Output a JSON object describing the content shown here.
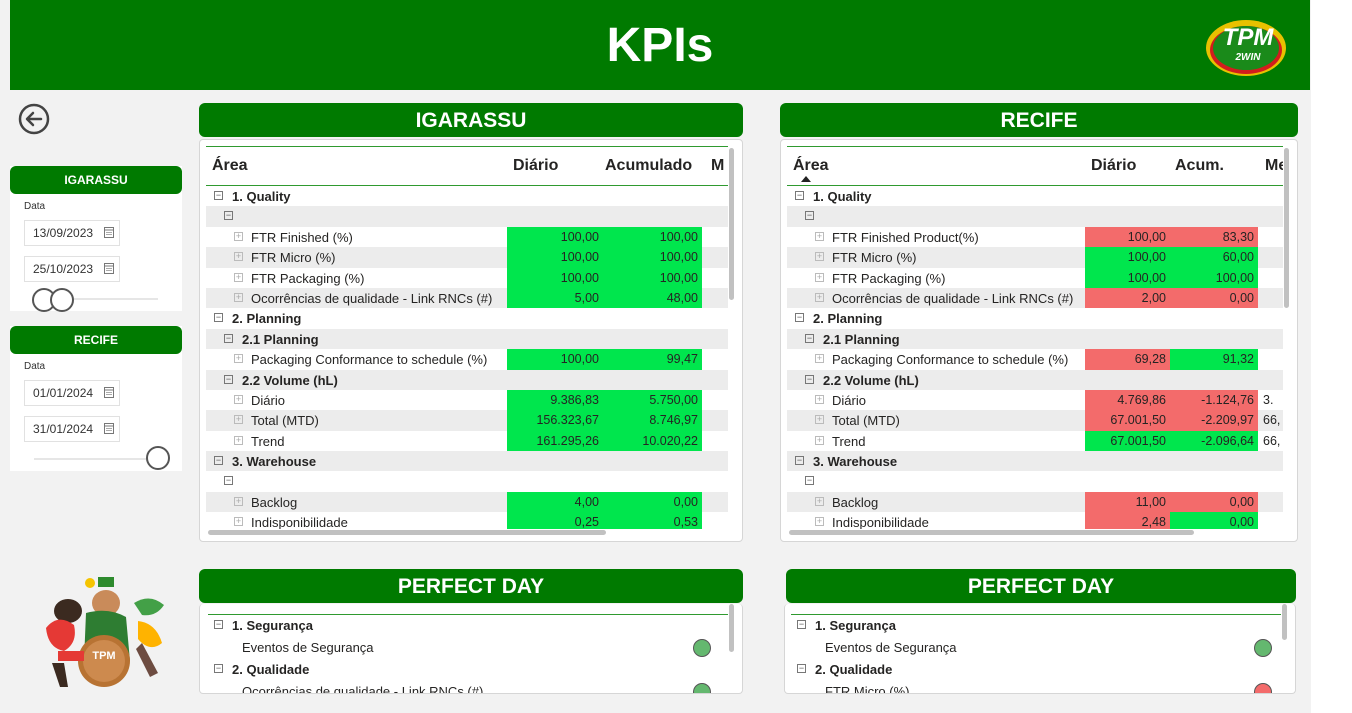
{
  "header": {
    "title": "KPIs",
    "logo_text": "TPM",
    "logo_sub": "2WIN"
  },
  "filters": [
    {
      "title": "IGARASSU",
      "label": "Data",
      "start": "13/09/2023",
      "end": "25/10/2023"
    },
    {
      "title": "RECIFE",
      "label": "Data",
      "start": "01/01/2024",
      "end": "31/01/2024"
    }
  ],
  "igarassu": {
    "title": "IGARASSU",
    "columns": {
      "area": "Área",
      "daily": "Diário",
      "acc": "Acumulado",
      "more": "M"
    },
    "rows": [
      {
        "label": "1. Quality",
        "level": 0,
        "bold": true,
        "exp": "⊟"
      },
      {
        "label": "",
        "level": 1,
        "exp": "⊟"
      },
      {
        "label": "FTR Finished (%)",
        "level": 2,
        "exp": "⊞",
        "d": "100,00",
        "a": "100,00",
        "dc": "g",
        "ac": "g"
      },
      {
        "label": "FTR Micro (%)",
        "level": 2,
        "exp": "⊞",
        "d": "100,00",
        "a": "100,00",
        "dc": "g",
        "ac": "g"
      },
      {
        "label": "FTR Packaging (%)",
        "level": 2,
        "exp": "⊞",
        "d": "100,00",
        "a": "100,00",
        "dc": "g",
        "ac": "g"
      },
      {
        "label": "Ocorrências de qualidade - Link RNCs (#)",
        "level": 2,
        "exp": "⊞",
        "d": "5,00",
        "a": "48,00",
        "dc": "g",
        "ac": "g"
      },
      {
        "label": "2. Planning",
        "level": 0,
        "bold": true,
        "exp": "⊟"
      },
      {
        "label": "2.1 Planning",
        "level": 1,
        "bold": true,
        "exp": "⊟"
      },
      {
        "label": "Packaging Conformance to schedule (%)",
        "level": 2,
        "exp": "⊞",
        "d": "100,00",
        "a": "99,47",
        "dc": "g",
        "ac": "g"
      },
      {
        "label": "2.2 Volume (hL)",
        "level": 1,
        "bold": true,
        "exp": "⊟"
      },
      {
        "label": "Diário",
        "level": 2,
        "exp": "⊞",
        "d": "9.386,83",
        "a": "5.750,00",
        "dc": "g",
        "ac": "g"
      },
      {
        "label": "Total (MTD)",
        "level": 2,
        "exp": "⊞",
        "d": "156.323,67",
        "a": "8.746,97",
        "dc": "g",
        "ac": "g"
      },
      {
        "label": "Trend",
        "level": 2,
        "exp": "⊞",
        "d": "161.295,26",
        "a": "10.020,22",
        "dc": "g",
        "ac": "g"
      },
      {
        "label": "3. Warehouse",
        "level": 0,
        "bold": true,
        "exp": "⊟"
      },
      {
        "label": "",
        "level": 1,
        "exp": "⊟"
      },
      {
        "label": "Backlog",
        "level": 2,
        "exp": "⊞",
        "d": "4,00",
        "a": "0,00",
        "dc": "g",
        "ac": "g"
      },
      {
        "label": "Indisponibilidade",
        "level": 2,
        "exp": "⊞",
        "d": "0,25",
        "a": "0,53",
        "dc": "g",
        "ac": "g"
      }
    ]
  },
  "recife": {
    "title": "RECIFE",
    "columns": {
      "area": "Área",
      "daily": "Diário",
      "acc": "Acum.",
      "more": "Me"
    },
    "rows": [
      {
        "label": "1. Quality",
        "level": 0,
        "bold": true,
        "exp": "⊟"
      },
      {
        "label": "",
        "level": 1,
        "exp": "⊟"
      },
      {
        "label": "FTR Finished Product(%)",
        "level": 2,
        "exp": "⊞",
        "d": "100,00",
        "a": "83,30",
        "dc": "r",
        "ac": "r"
      },
      {
        "label": "FTR Micro (%)",
        "level": 2,
        "exp": "⊞",
        "d": "100,00",
        "a": "60,00",
        "dc": "g",
        "ac": "g"
      },
      {
        "label": "FTR Packaging (%)",
        "level": 2,
        "exp": "⊞",
        "d": "100,00",
        "a": "100,00",
        "dc": "g",
        "ac": "g"
      },
      {
        "label": "Ocorrências de qualidade - Link RNCs (#)",
        "level": 2,
        "exp": "⊞",
        "d": "2,00",
        "a": "0,00",
        "dc": "r",
        "ac": "r"
      },
      {
        "label": "2. Planning",
        "level": 0,
        "bold": true,
        "exp": "⊟"
      },
      {
        "label": "2.1 Planning",
        "level": 1,
        "bold": true,
        "exp": "⊟"
      },
      {
        "label": "Packaging Conformance to schedule (%)",
        "level": 2,
        "exp": "⊞",
        "d": "69,28",
        "a": "91,32",
        "dc": "r",
        "ac": "g"
      },
      {
        "label": "2.2 Volume (hL)",
        "level": 1,
        "bold": true,
        "exp": "⊟"
      },
      {
        "label": "Diário",
        "level": 2,
        "exp": "⊞",
        "d": "4.769,86",
        "a": "-1.124,76",
        "m": "3.",
        "dc": "r",
        "ac": "r"
      },
      {
        "label": "Total (MTD)",
        "level": 2,
        "exp": "⊞",
        "d": "67.001,50",
        "a": "-2.209,97",
        "m": "66,",
        "dc": "r",
        "ac": "r"
      },
      {
        "label": "Trend",
        "level": 2,
        "exp": "⊞",
        "d": "67.001,50",
        "a": "-2.096,64",
        "m": "66,",
        "dc": "g",
        "ac": "g"
      },
      {
        "label": "3. Warehouse",
        "level": 0,
        "bold": true,
        "exp": "⊟"
      },
      {
        "label": "",
        "level": 1,
        "exp": "⊟"
      },
      {
        "label": "Backlog",
        "level": 2,
        "exp": "⊞",
        "d": "11,00",
        "a": "0,00",
        "dc": "r",
        "ac": "r"
      },
      {
        "label": "Indisponibilidade",
        "level": 2,
        "exp": "⊞",
        "d": "2,48",
        "a": "0,00",
        "dc": "r",
        "ac": "g"
      }
    ]
  },
  "perfect_day_left": {
    "title": "PERFECT DAY",
    "rows": [
      {
        "label": "1. Segurança",
        "bold": true,
        "exp": "⊟"
      },
      {
        "label": "Eventos de Segurança",
        "status": "ok"
      },
      {
        "label": "2. Qualidade",
        "bold": true,
        "exp": "⊟"
      },
      {
        "label": "Ocorrências de qualidade - Link RNCs (#)",
        "status": "ok"
      }
    ]
  },
  "perfect_day_right": {
    "title": "PERFECT DAY",
    "rows": [
      {
        "label": "1. Segurança",
        "bold": true,
        "exp": "⊟"
      },
      {
        "label": "Eventos de Segurança",
        "status": "ok"
      },
      {
        "label": "2. Qualidade",
        "bold": true,
        "exp": "⊟"
      },
      {
        "label": "FTR Micro (%)",
        "status": "bad"
      }
    ]
  },
  "colors": {
    "brand_green": "#007a00",
    "good": "#00e64d",
    "bad": "#f36b6b"
  }
}
